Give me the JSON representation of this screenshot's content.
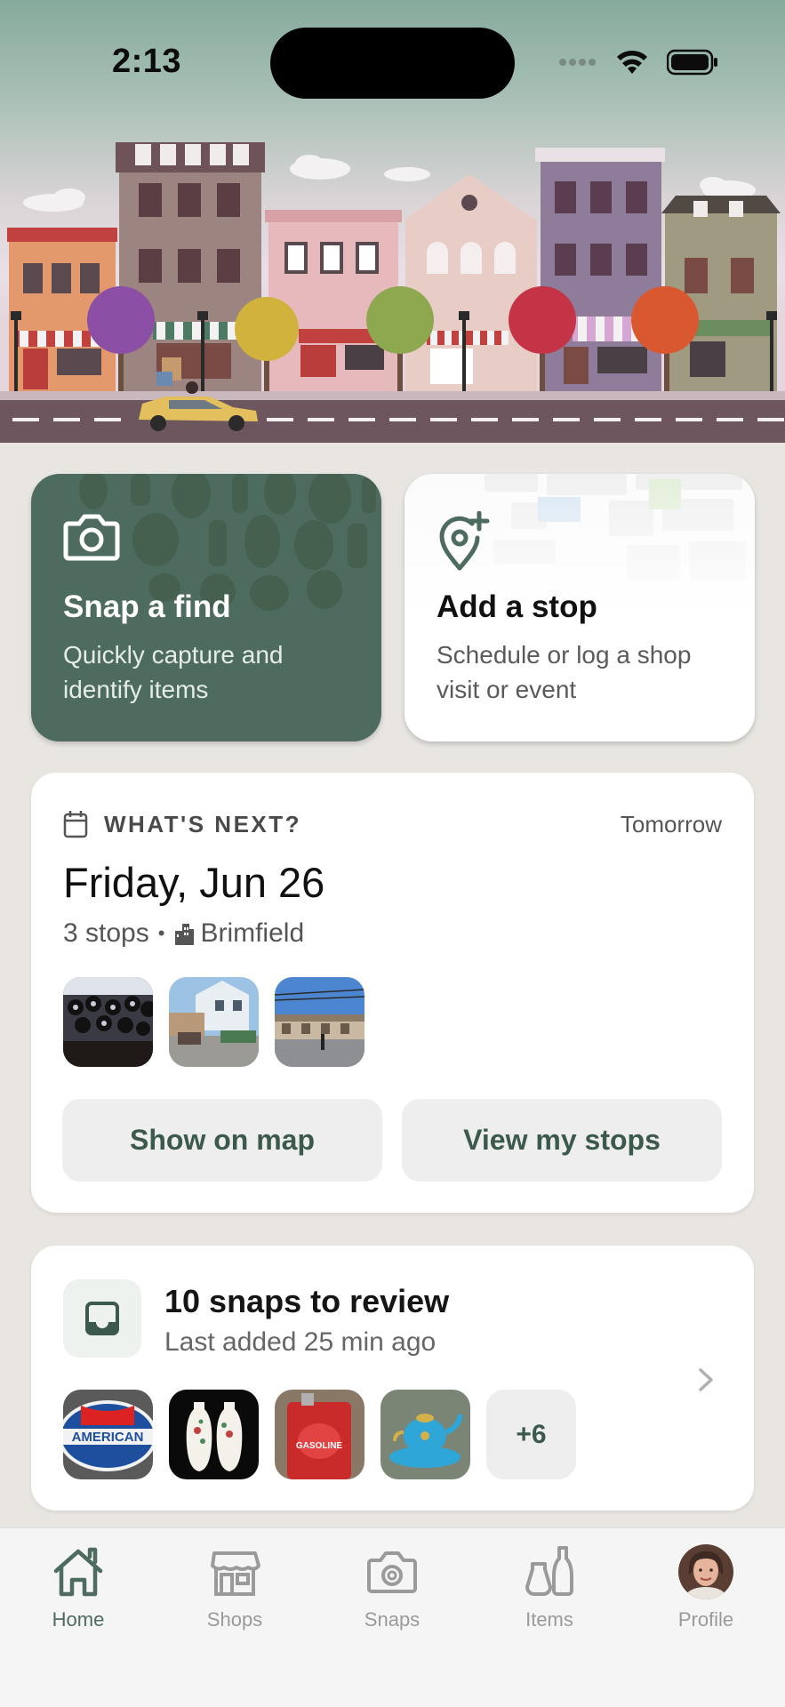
{
  "status_bar": {
    "time": "2:13"
  },
  "actions": {
    "snap": {
      "title": "Snap a find",
      "subtitle": "Quickly capture and identify items"
    },
    "stop": {
      "title": "Add a stop",
      "subtitle": "Schedule or log a shop visit or event"
    }
  },
  "next": {
    "label": "WHAT'S NEXT?",
    "when": "Tomorrow",
    "date": "Friday, Jun 26",
    "stops": "3 stops",
    "location": "Brimfield",
    "show_map": "Show on map",
    "view_stops": "View my stops"
  },
  "review": {
    "title": "10 snaps to review",
    "subtitle": "Last added 25 min ago",
    "more": "+6",
    "thumb_labels": {
      "american_sign": "AMERICAN",
      "gas_can": "GASOLINE"
    }
  },
  "tabs": [
    {
      "label": "Home",
      "icon": "home-icon",
      "active": true
    },
    {
      "label": "Shops",
      "icon": "storefront-icon",
      "active": false
    },
    {
      "label": "Snaps",
      "icon": "camera-icon",
      "active": false
    },
    {
      "label": "Items",
      "icon": "vases-icon",
      "active": false
    },
    {
      "label": "Profile",
      "icon": "avatar",
      "active": false
    }
  ],
  "colors": {
    "brand_green": "#4d6b5e",
    "page_bg": "#e9e6e2",
    "card_bg": "#ffffff"
  }
}
